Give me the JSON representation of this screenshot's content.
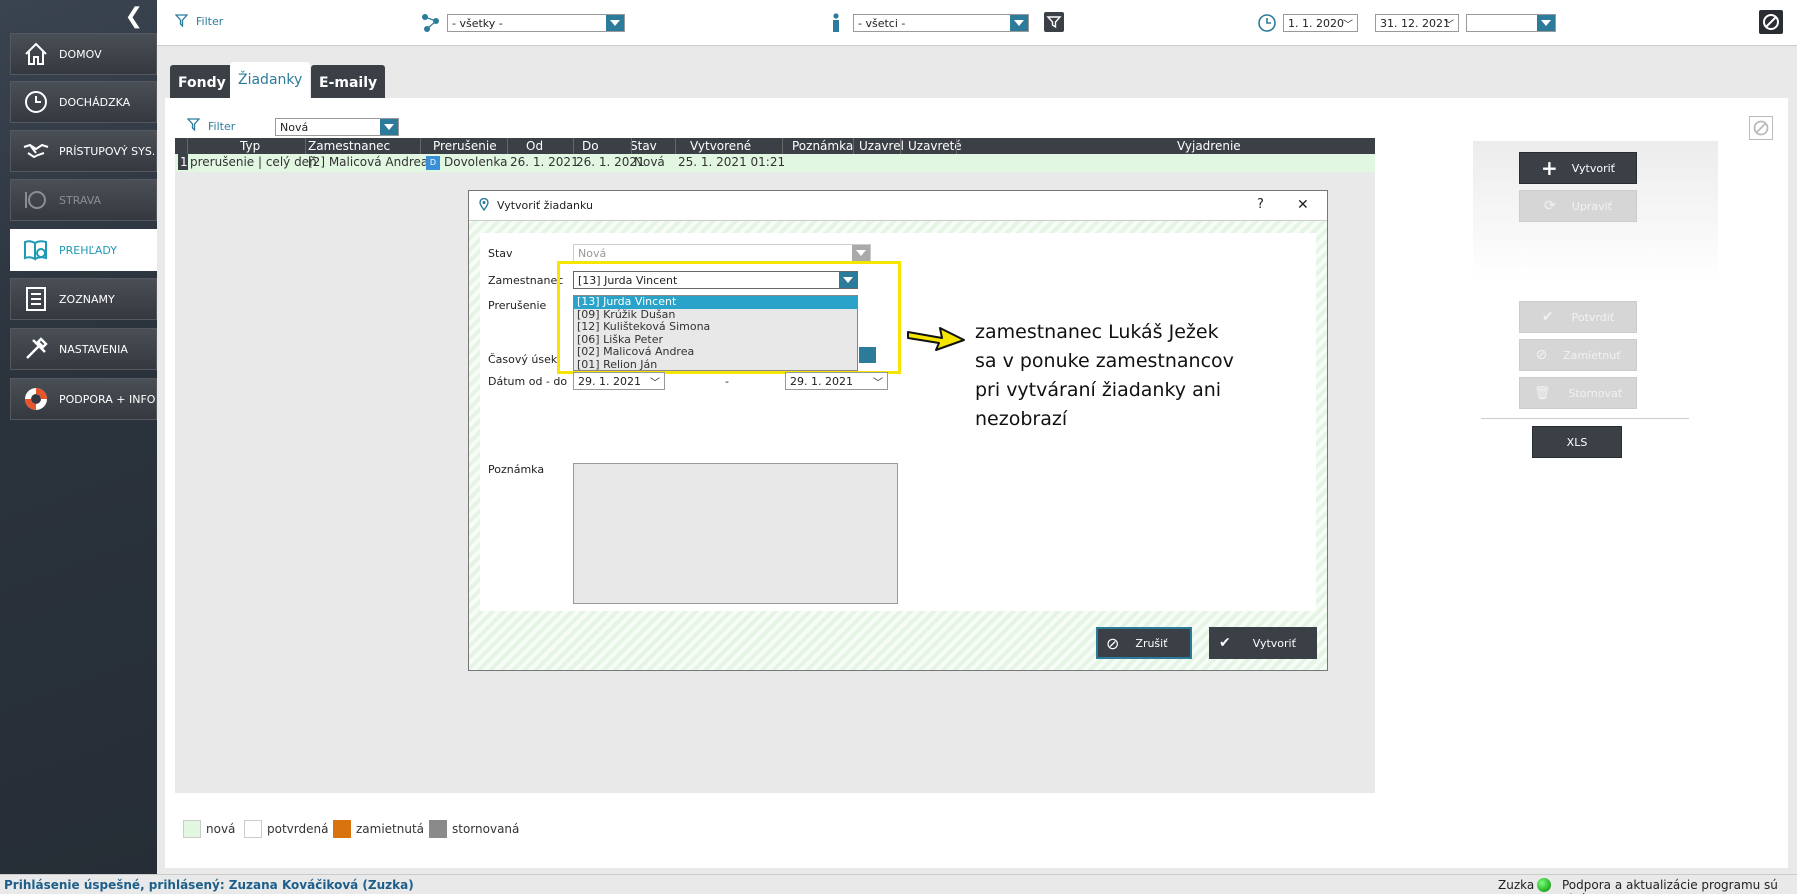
{
  "sidebar": {
    "items": [
      {
        "label": "DOMOV",
        "icon": "home-icon",
        "state": "normal"
      },
      {
        "label": "DOCHÁDZKA",
        "icon": "clock-icon",
        "state": "normal"
      },
      {
        "label": "PRÍSTUPOVÝ SYS.",
        "icon": "handshake-icon",
        "state": "normal"
      },
      {
        "label": "STRAVA",
        "icon": "plate-icon",
        "state": "disabled"
      },
      {
        "label": "PREHĽADY",
        "icon": "report-icon",
        "state": "active"
      },
      {
        "label": "ZOZNAMY",
        "icon": "list-icon",
        "state": "normal"
      },
      {
        "label": "NASTAVENIA",
        "icon": "tools-icon",
        "state": "normal"
      },
      {
        "label": "PODPORA + INFO",
        "icon": "lifebuoy-icon",
        "state": "normal"
      }
    ]
  },
  "topbar": {
    "filter_label": "Filter",
    "group_select": "- všetky -",
    "person_select": "- všetci -",
    "date_from": "1. 1. 2020",
    "date_to": "31. 12. 2021",
    "extra_select": ""
  },
  "tabs": [
    {
      "label": "Fondy",
      "active": false
    },
    {
      "label": "Žiadanky",
      "active": true
    },
    {
      "label": "E-maily",
      "active": false
    }
  ],
  "panel": {
    "filter_label": "Filter",
    "state_filter": "Nová"
  },
  "table": {
    "columns": [
      "Typ",
      "Zamestnanec",
      "Prerušenie",
      "Od",
      "Do",
      "Stav",
      "Vytvorené",
      "Poznámka",
      "Uzavrel",
      "Uzavreté",
      "Vyjadrenie"
    ],
    "rows": [
      {
        "num": "1",
        "typ": "prerušenie | celý deň",
        "zamestnanec": "[2] Malicová Andrea",
        "badge": "D",
        "prerusenie": "Dovolenka",
        "od": "26. 1. 2021",
        "do": "26. 1. 2021",
        "stav": "Nová",
        "vytvorene": "25. 1. 2021  01:21"
      }
    ]
  },
  "right_buttons": {
    "create": "Vytvoriť",
    "edit": "Upraviť",
    "confirm": "Potvrdiť",
    "reject": "Zamietnuť",
    "cancel": "Stornovať",
    "xls": "XLS"
  },
  "legend": [
    {
      "label": "nová",
      "color": "#e2f7e2"
    },
    {
      "label": "potvrdená",
      "color": "#ffffff"
    },
    {
      "label": "zamietnutá",
      "color": "#d9730d"
    },
    {
      "label": "stornovaná",
      "color": "#8a8a8a"
    }
  ],
  "dialog": {
    "title": "Vytvoriť žiadanku",
    "help": "?",
    "close": "✕",
    "labels": {
      "stav": "Stav",
      "zamestnanec": "Zamestnanec",
      "prerusenie": "Prerušenie",
      "casovy_usek": "Časový úsek",
      "datum": "Dátum od - do",
      "poznamka": "Poznámka",
      "dash": "-"
    },
    "stav_value": "Nová",
    "zamestnanec_value": "[13] Jurda Vincent",
    "employee_options": [
      "[13] Jurda Vincent",
      "[09] Krúžik Dušan",
      "[12] Kulišteková Simona",
      "[06] Liška Peter",
      "[02] Malicová Andrea",
      "[01] Relion Ján"
    ],
    "date_from": "29. 1. 2021",
    "date_to": "29. 1. 2021",
    "cancel": "Zrušiť",
    "create": "Vytvoriť"
  },
  "annotation": "zamestnanec Lukáš Ježek sa v ponuke zamestnancov pri vytváraní žiadanky ani nezobrazí",
  "statusbar": {
    "login": "Prihlásenie úspešné, prihlásený: Zuzana Kováčiková (Zuzka)",
    "user": "Zuzka",
    "update": "Podpora a aktualizácie programu sú aktívne"
  },
  "colors": {
    "accent": "#2c7b9b",
    "dark": "#3b4046",
    "highlight": "#f5e500"
  }
}
